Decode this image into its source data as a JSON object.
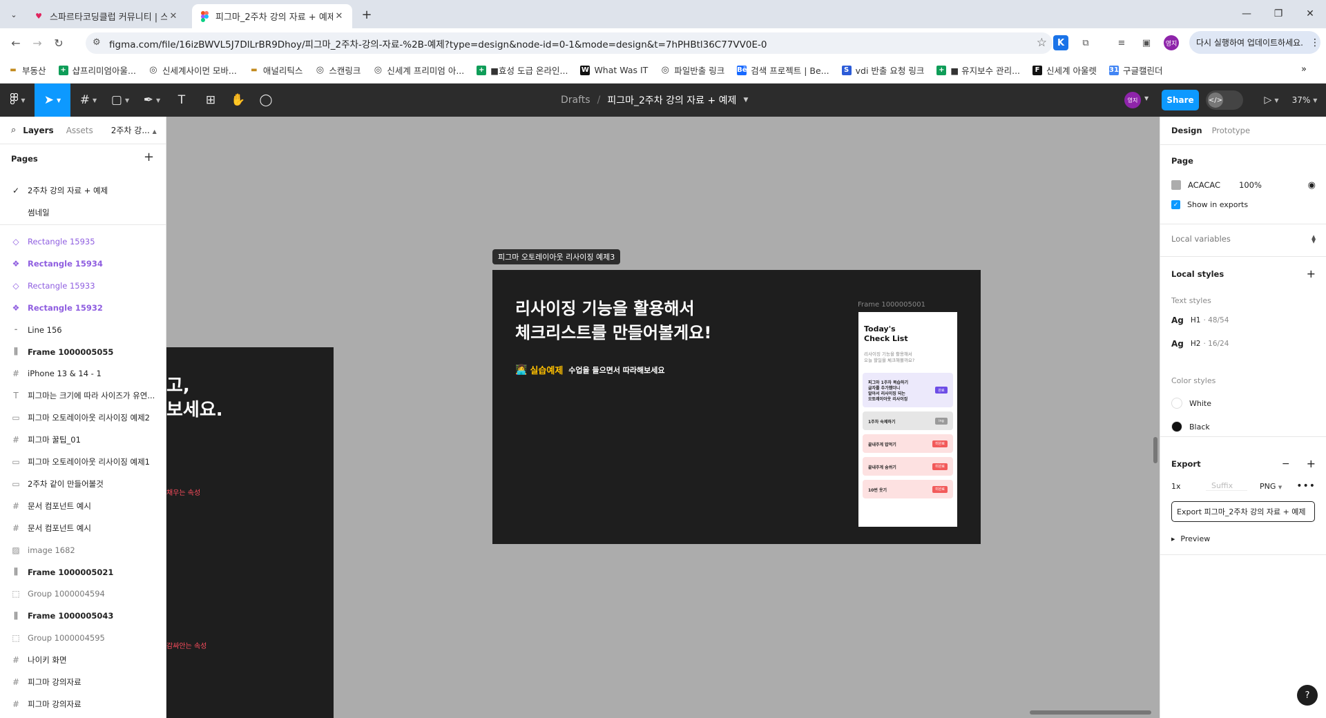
{
  "browser": {
    "tabs": [
      {
        "title": "스파르타코딩클럽 커뮤니티 | 스",
        "icon": "heart-icon"
      },
      {
        "title": "피그마_2주차 강의 자료 + 예제",
        "icon": "figma-icon"
      }
    ],
    "url": "figma.com/file/16izBWVL5J7DlLrBR9Dhoy/피그마_2주차-강의-자료-%2B-예제?type=design&node-id=0-1&mode=design&t=7hPHBtl36C77VV0E-0",
    "update_label": "다시 실행하여 업데이트하세요.",
    "profile_label": "영지",
    "bookmarks": [
      {
        "label": "부동산",
        "icon": "folder-icon"
      },
      {
        "label": "샵프리미엄아울...",
        "icon": "sheets-icon"
      },
      {
        "label": "신세계사이먼 모바...",
        "icon": "globe-icon"
      },
      {
        "label": "애널리틱스",
        "icon": "folder-icon"
      },
      {
        "label": "스캔링크",
        "icon": "globe-icon"
      },
      {
        "label": "신세계 프리미엄 아...",
        "icon": "globe-icon"
      },
      {
        "label": "■효성 도급 온라인...",
        "icon": "sheets-icon"
      },
      {
        "label": "What Was IT",
        "icon": "w-icon"
      },
      {
        "label": "파일반출 링크",
        "icon": "globe-icon"
      },
      {
        "label": "검색 프로젝트 | Be...",
        "icon": "behance-icon"
      },
      {
        "label": "vdi 반출 요청 링크",
        "icon": "s-icon"
      },
      {
        "label": "■ 유지보수 관리...",
        "icon": "sheets-icon"
      },
      {
        "label": "신세계 아울렛",
        "icon": "ft-icon"
      },
      {
        "label": "구글캘린더",
        "icon": "calendar-icon"
      }
    ]
  },
  "figma": {
    "breadcrumb": {
      "root": "Drafts",
      "sep": "/",
      "file": "피그마_2주차 강의 자료 + 예제"
    },
    "user_badge": "영지",
    "share_label": "Share",
    "zoom": "37%",
    "left": {
      "tab_layers": "Layers",
      "tab_assets": "Assets",
      "page_select": "2주차 강...",
      "pages_title": "Pages",
      "pages": [
        {
          "label": "2주차 강의 자료 + 예제",
          "checked": true
        },
        {
          "label": "썸네일",
          "checked": false
        }
      ],
      "layers": [
        {
          "label": "Rectangle 15935",
          "icon": "component-outline-icon",
          "style": "comp"
        },
        {
          "label": "Rectangle 15934",
          "icon": "component-icon",
          "style": "comp bold"
        },
        {
          "label": "Rectangle 15933",
          "icon": "component-outline-icon",
          "style": "comp"
        },
        {
          "label": "Rectangle 15932",
          "icon": "component-icon",
          "style": "comp bold"
        },
        {
          "label": "Line 156",
          "icon": "line-icon",
          "style": ""
        },
        {
          "label": "Frame 1000005055",
          "icon": "autolayout-icon",
          "style": "bold"
        },
        {
          "label": "iPhone 13 & 14 - 1",
          "icon": "frame-icon",
          "style": ""
        },
        {
          "label": "피그마는 크기에 따라 사이즈가 유연...",
          "icon": "text-icon",
          "style": ""
        },
        {
          "label": "피그마 오토레이아웃 리사이징 예제2",
          "icon": "section-icon",
          "style": ""
        },
        {
          "label": "피그마 꿀팁_01",
          "icon": "frame-icon",
          "style": ""
        },
        {
          "label": "피그마 오토레이아웃 리사이징 예제1",
          "icon": "section-icon",
          "style": ""
        },
        {
          "label": "2주차 같이 만들어볼것",
          "icon": "section-icon",
          "style": ""
        },
        {
          "label": "문서 컴포넌트 예시",
          "icon": "frame-icon",
          "style": ""
        },
        {
          "label": "문서 컴포넌트 예시",
          "icon": "frame-icon",
          "style": ""
        },
        {
          "label": "image 1682",
          "icon": "image-icon",
          "style": "gray"
        },
        {
          "label": "Frame 1000005021",
          "icon": "autolayout-icon",
          "style": "bold"
        },
        {
          "label": "Group 1000004594",
          "icon": "group-icon",
          "style": "gray"
        },
        {
          "label": "Frame 1000005043",
          "icon": "autolayout-icon",
          "style": "bold"
        },
        {
          "label": "Group 1000004595",
          "icon": "group-icon",
          "style": "gray"
        },
        {
          "label": "나이키 화면",
          "icon": "frame-icon",
          "style": ""
        },
        {
          "label": "피그마 강의자료",
          "icon": "frame-icon",
          "style": ""
        },
        {
          "label": "피그마 강의자료",
          "icon": "frame-icon",
          "style": ""
        }
      ]
    },
    "canvas": {
      "bg_color": "#ACACAC",
      "left_frame": {
        "line1": "고,",
        "line2": "보세요.",
        "note1": "채우는 속성",
        "note2": "감싸안는 속성"
      },
      "main_frame": {
        "label": "피그마 오토레이아웃 리사이징 예제3",
        "heading_line1": "리사이징 기능을 활용해서",
        "heading_line2": "체크리스트를 만들어볼게요!",
        "practice_emoji": "👩‍💻",
        "practice_label": "실습예제",
        "practice_text": "수업을 들으면서 따라해보세요",
        "phone_frame_label": "Frame 1000005001",
        "phone": {
          "title_line1": "Today's",
          "title_line2": "Check List",
          "sub_line1": "리사이징 기능을 활용해서",
          "sub_line2": "오늘 할일을 체크해볼까요?",
          "items": [
            {
              "lines": [
                "피그마 1주차 복습하기",
                "글자를 추가했더니",
                "알아서 리사이징 되는",
                "오토레이아웃 리사이징"
              ],
              "badge": "완료",
              "tone": "purple"
            },
            {
              "lines": [
                "1주차 숙제하기"
              ],
              "badge": "ing",
              "tone": "gray"
            },
            {
              "lines": [
                "끝내주게 밥먹기"
              ],
              "badge": "미완료",
              "tone": "pink"
            },
            {
              "lines": [
                "끝내주게 숨쉬기"
              ],
              "badge": "미완료",
              "tone": "pink"
            },
            {
              "lines": [
                "10번 웃기"
              ],
              "badge": "미완료",
              "tone": "pink"
            }
          ]
        }
      }
    },
    "right": {
      "tab_design": "Design",
      "tab_prototype": "Prototype",
      "page_title": "Page",
      "page_color": "ACACAC",
      "page_opacity": "100%",
      "show_exports": "Show in exports",
      "local_variables": "Local variables",
      "local_styles": "Local styles",
      "text_styles": "Text styles",
      "text_style_items": [
        {
          "ag": "Ag",
          "name": "H1",
          "meta": "· 48/54"
        },
        {
          "ag": "Ag",
          "name": "H2",
          "meta": "· 16/24"
        }
      ],
      "color_styles": "Color styles",
      "color_items": [
        {
          "name": "White",
          "color": "#FFFFFF"
        },
        {
          "name": "Black",
          "color": "#111111"
        }
      ],
      "export_title": "Export",
      "export_scale": "1x",
      "export_suffix_placeholder": "Suffix",
      "export_format": "PNG",
      "export_button": "Export 피그마_2주차 강의 자료 + 예제",
      "preview": "Preview"
    },
    "help": "?"
  },
  "colors": {
    "accent": "#0d99ff",
    "toolbar": "#2c2c2c",
    "component": "#8f5ee0",
    "dark_frame": "#1e1e1e",
    "practice": "#ffc000"
  }
}
